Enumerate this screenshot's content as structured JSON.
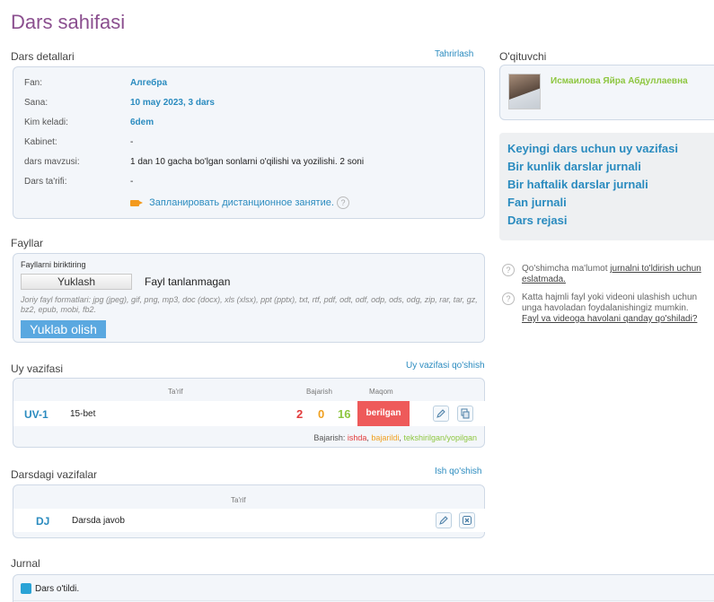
{
  "page": {
    "title": "Dars sahifasi"
  },
  "details": {
    "section_label": "Dars detallari",
    "edit_link": "Tahrirlash",
    "rows": [
      {
        "label": "Fan:",
        "value": "Алгебра"
      },
      {
        "label": "Sana:",
        "value": "10 may 2023, 3 dars"
      },
      {
        "label": "Kim keladi:",
        "value": "6dem"
      },
      {
        "label": "Kabinet:",
        "value": "-"
      },
      {
        "label": "dars mavzusi:",
        "value": "1 dan 10 gacha bo'lgan sonlarni o'qilishi va yozilishi. 2 soni"
      },
      {
        "label": "Dars ta'rifi:",
        "value": "-"
      }
    ],
    "distance_link": "Запланировать дистанционное занятие.",
    "help": "?"
  },
  "teacher": {
    "section_label": "O'qituvchi",
    "name": "Исмаилова Яйра Абдуллаевна"
  },
  "side_links": [
    "Keyingi dars uchun uy vazifasi",
    "Bir kunlik darslar jurnali",
    "Bir haftalik darslar jurnali",
    "Fan jurnali",
    "Dars rejasi"
  ],
  "side_help": {
    "item1_text": "Qo'shimcha ma'lumot ",
    "item1_link": "jurnalni to'ldirish uchun",
    "item1_line2": "eslatmada.",
    "item2_line1": "Katta hajmli fayl yoki videoni ulashish uchun",
    "item2_line2": "unga havoladan foydalanishingiz mumkin.",
    "item2_link": "Fayl va videoga havolani qanday qo'shiladi?"
  },
  "files": {
    "section_label": "Fayllar",
    "attach_label": "Fayllarni biriktiring",
    "choose_button": "Yuklash",
    "no_file": "Fayl tanlanmagan",
    "formats_prefix": "Joriy fayl formatlari: ",
    "formats": "jpg (jpeg), gif, png, mp3, doc (docx), xls (xlsx), ppt (pptx), txt, rtf, pdf, odt, odf, odp, ods, odg, zip, rar, tar, gz, bz2, epub, mobi, fb2.",
    "upload_button": "Yuklab olish"
  },
  "homework": {
    "section_label": "Uy vazifasi",
    "add_link": "Uy vazifasi qo'shish",
    "col_desc": "Ta'rif",
    "col_done": "Bajarish",
    "col_status": "Maqom",
    "row": {
      "code": "UV-1",
      "desc": "15-bet",
      "red": "2",
      "orange": "0",
      "green": "16",
      "status": "berilgan"
    },
    "legend_prefix": "Bajarish: ",
    "legend_red": "ishda",
    "legend_orange": "bajarildi",
    "legend_green": "tekshirilgan/yopilgan"
  },
  "classwork": {
    "section_label": "Darsdagi vazifalar",
    "add_link": "Ish qo'shish",
    "col_desc": "Ta'rif",
    "row": {
      "code": "DJ",
      "desc": "Darsda javob"
    }
  },
  "journal": {
    "section_label": "Jurnal",
    "status": "Dars o'tildi."
  },
  "colors": {
    "title": "#8b4f8f",
    "link": "#2a8bbf",
    "status_red": "#ee5a5a",
    "green": "#8dc63f"
  }
}
